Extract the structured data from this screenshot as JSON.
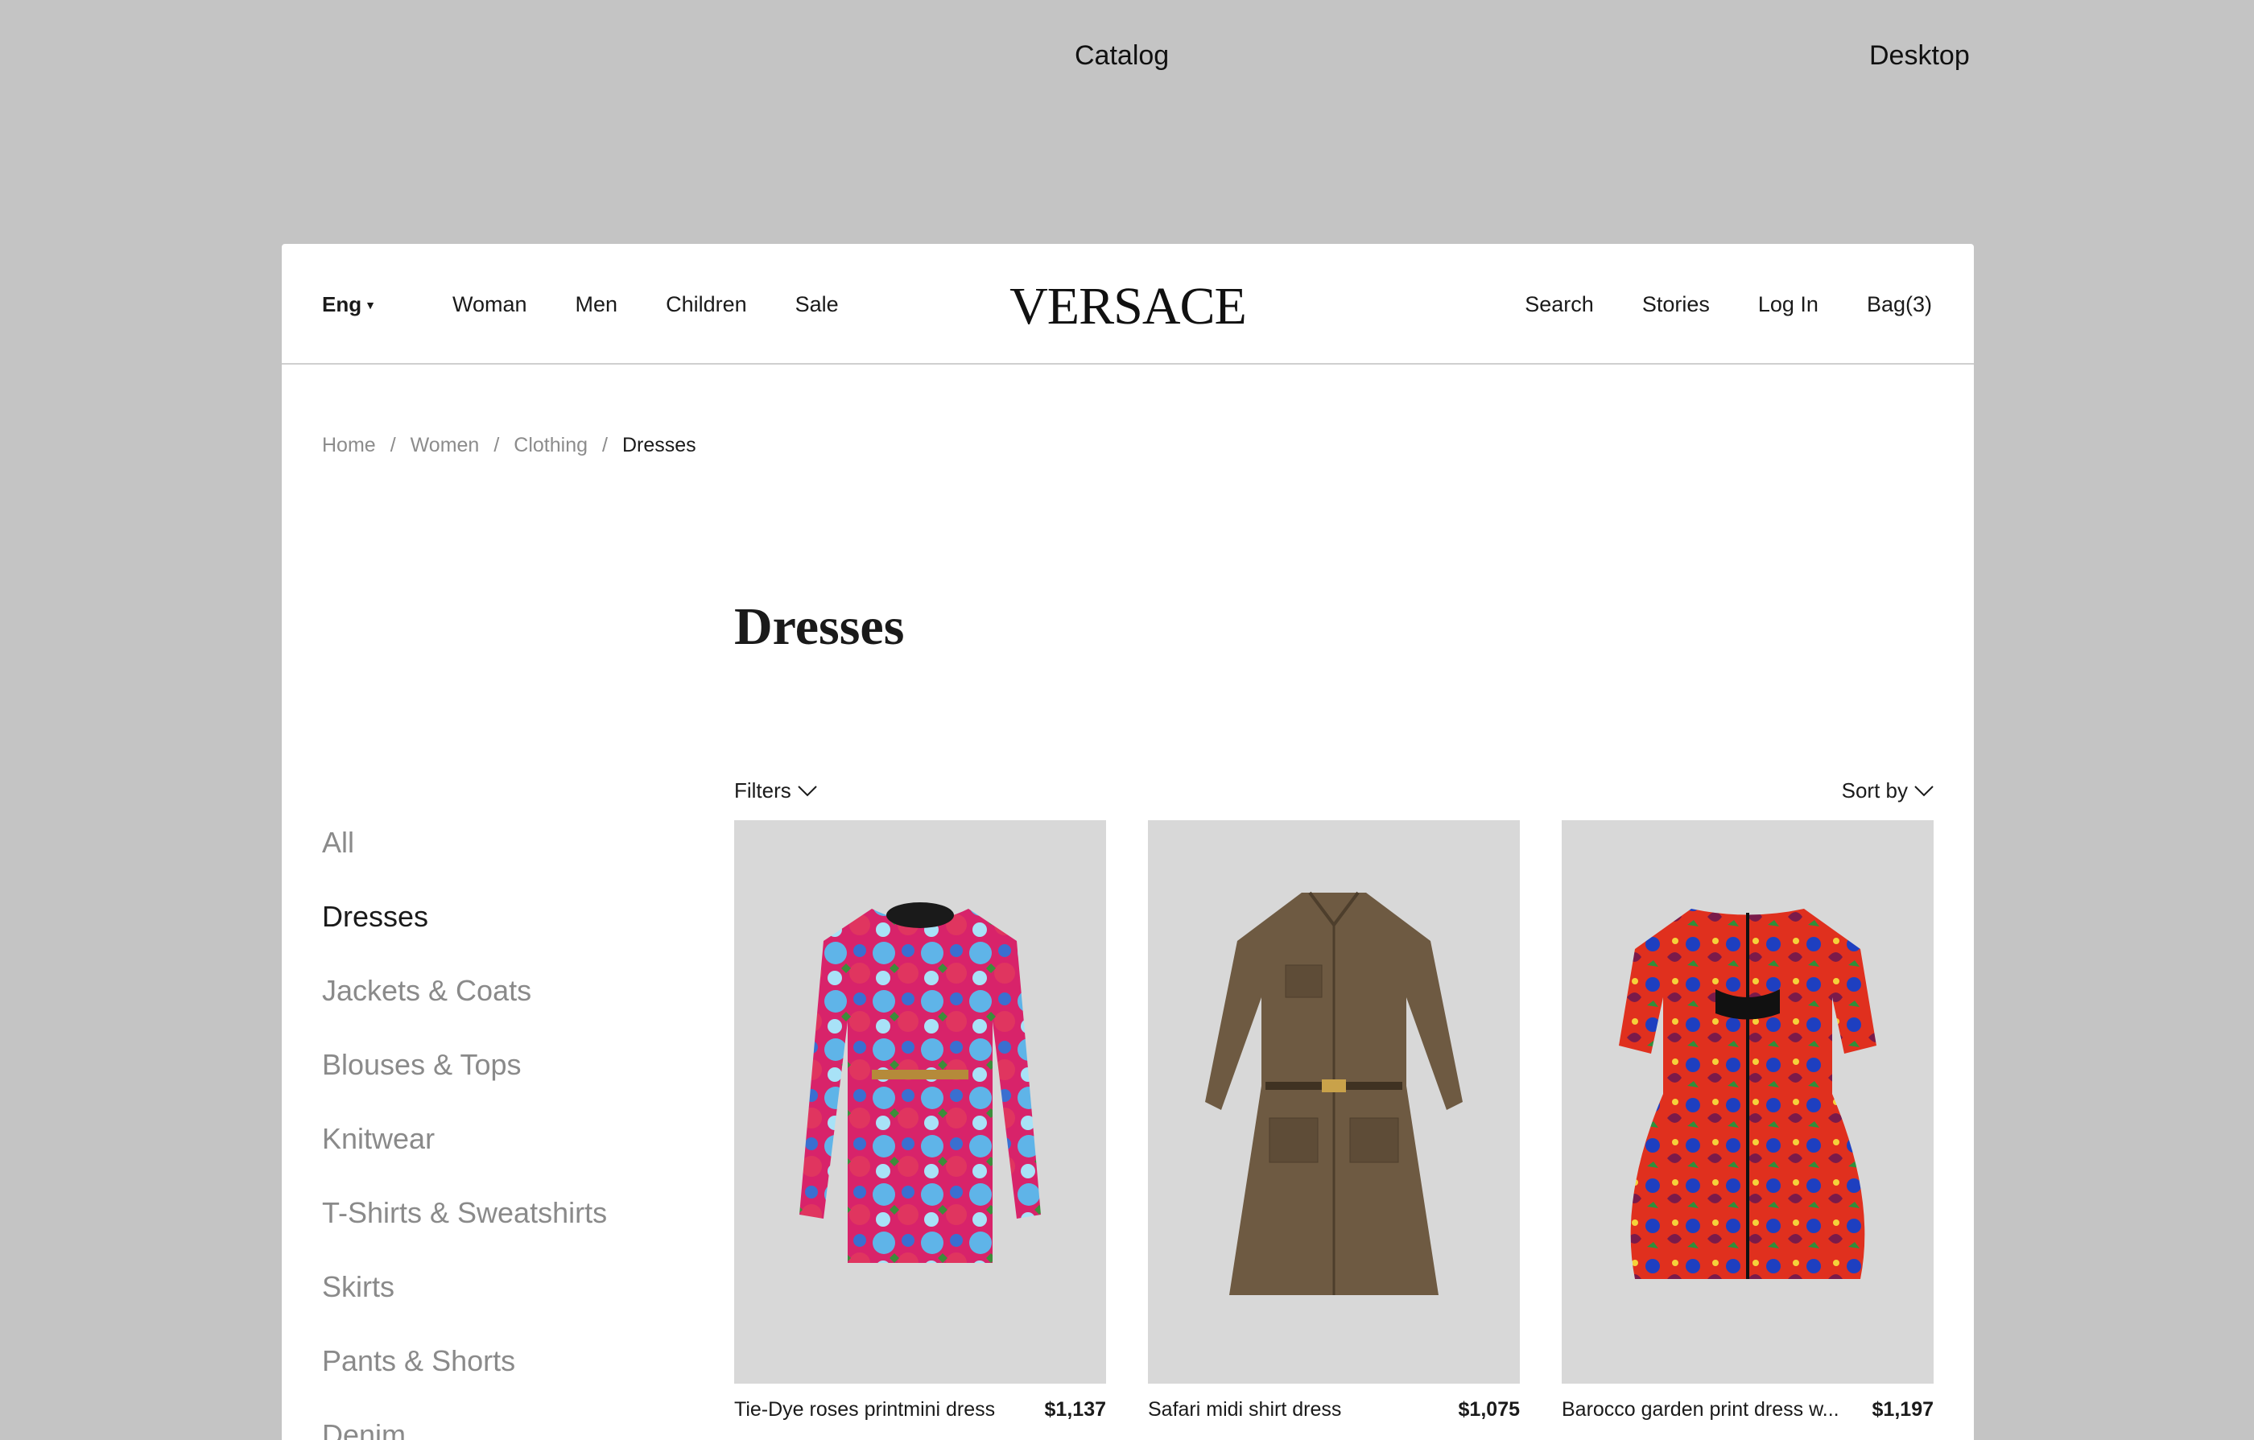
{
  "frame": {
    "catalog_label": "Catalog",
    "desktop_label": "Desktop"
  },
  "header": {
    "lang": "Eng",
    "nav_left": [
      "Woman",
      "Men",
      "Children",
      "Sale"
    ],
    "logo": "VERSACE",
    "nav_right": [
      "Search",
      "Stories",
      "Log In",
      "Bag(3)"
    ]
  },
  "breadcrumb": {
    "items": [
      "Home",
      "Women",
      "Clothing"
    ],
    "current": "Dresses",
    "separator": "/"
  },
  "page": {
    "title": "Dresses"
  },
  "sidebar": {
    "items": [
      "All",
      "Dresses",
      "Jackets & Coats",
      "Blouses & Tops",
      "Knitwear",
      "T-Shirts & Sweatshirts",
      "Skirts",
      "Pants & Shorts",
      "Denim"
    ],
    "active": "Dresses"
  },
  "toolbar": {
    "filters_label": "Filters",
    "sort_label": "Sort by"
  },
  "products": [
    {
      "name": "Tie-Dye  roses printmini dress",
      "price": "$1,137"
    },
    {
      "name": "Safari midi shirt dress",
      "price": "$1,075"
    },
    {
      "name": "Barocco garden print dress w...",
      "price": "$1,197"
    }
  ]
}
